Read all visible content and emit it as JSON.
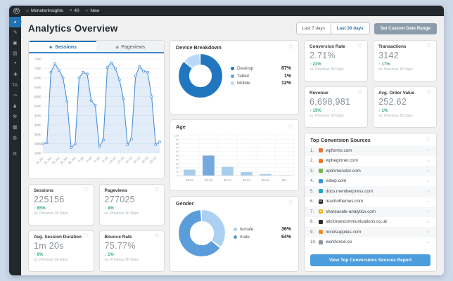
{
  "colors": {
    "accent_blue": "#2271b1",
    "button_blue": "#4b9ddd",
    "green_change": "#2fa97c",
    "admin_dark": "#23282d",
    "page_bg": "#f0f0f1"
  },
  "icons": {
    "info": "ⓘ",
    "chevron_down": "⌄",
    "arrow_up": "↑",
    "arrow_down": "↓",
    "home": "⌂",
    "comment": "❞",
    "plus": "+",
    "person": "☻",
    "eye": "◉",
    "logo_letter": "W"
  },
  "admin_bar": {
    "site_name": "MonsterInsights",
    "comments_count": "40",
    "new_label": "New"
  },
  "sidebar": {
    "items": [
      {
        "name": "dashboard",
        "glyph": "◕",
        "active": true
      },
      {
        "name": "posts",
        "glyph": "✎"
      },
      {
        "name": "media",
        "glyph": "▣"
      },
      {
        "name": "pages",
        "glyph": "▤"
      },
      {
        "name": "comments",
        "glyph": "❞"
      },
      {
        "name": "appearance",
        "glyph": "✚"
      },
      {
        "name": "text-ta",
        "glyph": "TA"
      },
      {
        "name": "plugins",
        "glyph": "✑"
      },
      {
        "name": "users",
        "glyph": "♟"
      },
      {
        "name": "tools",
        "glyph": "⚒"
      },
      {
        "name": "settings",
        "glyph": "▦"
      },
      {
        "name": "analytics",
        "glyph": "◍"
      },
      {
        "name": "collapse",
        "glyph": "⚙"
      }
    ]
  },
  "header": {
    "title": "Analytics Overview",
    "last7": "Last 7 days",
    "last30": "Last 30 days",
    "custom_range": "Set Custom Date Range"
  },
  "tabs": {
    "sessions": "Sessions",
    "pageviews": "Pageviews"
  },
  "panels": {
    "device": "Device Breakdown",
    "age": "Age",
    "gender": "Gender",
    "sources": "Top Conversion Sources"
  },
  "metrics_left": [
    {
      "label": "Sessions",
      "value": "225156",
      "change": "85%",
      "dir": "up",
      "vs": "vs. Previous 30 Days"
    },
    {
      "label": "Pageviews",
      "value": "277025",
      "change": "9%",
      "dir": "up",
      "vs": "vs. Previous 30 Days"
    },
    {
      "label": "Avg. Session Duration",
      "value": "1m 20s",
      "change": "6%",
      "dir": "up",
      "vs": "vs. Previous 30 Days"
    },
    {
      "label": "Bounce Rate",
      "value": "75.77%",
      "change": "1%",
      "dir": "down",
      "vs": "vs. Previous 30 Days"
    }
  ],
  "metrics_right": [
    {
      "label": "Conversion Rate",
      "value": "2.71%",
      "change": "22%",
      "dir": "up",
      "vs": "vs. Previous 30 Days"
    },
    {
      "label": "Transactions",
      "value": "3142",
      "change": "17%",
      "dir": "up",
      "vs": "vs. Previous 30 Days"
    },
    {
      "label": "Revenue",
      "value": "6,698,981",
      "change": "15%",
      "dir": "up",
      "vs": "vs. Previous 30 Days"
    },
    {
      "label": "Avg. Order Value",
      "value": "252.62",
      "change": "1%",
      "dir": "up",
      "vs": "vs. Previous 30 Days"
    }
  ],
  "sources": {
    "items": [
      {
        "rank": "1.",
        "domain": "wpforms.com",
        "color": "#e27730",
        "glyph": ""
      },
      {
        "rank": "2.",
        "domain": "wpbeginner.com",
        "color": "#f47a20",
        "glyph": ""
      },
      {
        "rank": "3.",
        "domain": "optinmonster.com",
        "color": "#6dbb45",
        "glyph": ""
      },
      {
        "rank": "4.",
        "domain": "isitwp.com",
        "color": "#3496d8",
        "glyph": ""
      },
      {
        "rank": "5.",
        "domain": "docs.memberpress.com",
        "color": "#1fa6c9",
        "glyph": ""
      },
      {
        "rank": "6.",
        "domain": "machothemes.com",
        "color": "#1d1f21",
        "glyph": "M"
      },
      {
        "rank": "7.",
        "domain": "shareasale-analytics.com",
        "color": "#f4b400",
        "glyph": "★"
      },
      {
        "rank": "8.",
        "domain": "stickmancommunications.co.uk",
        "color": "#2b2b2b",
        "glyph": ""
      },
      {
        "rank": "9.",
        "domain": "mindsupplies.com",
        "color": "#f08c1e",
        "glyph": ""
      },
      {
        "rank": "10.",
        "domain": "workforexl.co",
        "color": "#8e959c",
        "glyph": ""
      }
    ],
    "button_label": "View Top Conversions Sources Report"
  },
  "chart_data": [
    {
      "id": "sessions",
      "type": "line",
      "title": "Sessions",
      "x": [
        "22 Jun",
        "23 Jun",
        "24 Jun",
        "25 Jun",
        "26 Jun",
        "27 Jun",
        "28 Jun",
        "29 Jun",
        "30 Jun",
        "1 Jul",
        "2 Jul",
        "3 Jul",
        "4 Jul",
        "5 Jul",
        "6 Jul",
        "7 Jul",
        "8 Jul",
        "9 Jul",
        "10 Jul",
        "11 Jul",
        "12 Jul",
        "13 Jul",
        "14 Jul",
        "15 Jul",
        "16 Jul",
        "17 Jul",
        "18 Jul",
        "19 Jul",
        "20 Jul",
        "21 Jul"
      ],
      "values": [
        3000,
        3050,
        6800,
        7250,
        6900,
        6500,
        5250,
        2800,
        3000,
        6500,
        6800,
        6700,
        5300,
        5050,
        2850,
        3200,
        7050,
        7300,
        7000,
        6400,
        5400,
        2950,
        3250,
        6600,
        7100,
        6850,
        6800,
        5500,
        2950,
        3100
      ],
      "ylim": [
        2500,
        7500
      ],
      "ytick_step": 500,
      "xlabel_every": 2,
      "line_color": "#4a90d9",
      "fill_color": "rgba(74,144,217,0.16)",
      "grid": true,
      "legend_position": "none"
    },
    {
      "id": "device",
      "type": "pie",
      "title": "Device Breakdown",
      "labels": [
        "Desktop",
        "Tablet",
        "Mobile"
      ],
      "values": [
        87,
        1,
        12
      ],
      "display": [
        "87%",
        "1%",
        "12%"
      ],
      "colors": [
        "#2076bf",
        "#5aa7e0",
        "#b9d9f6"
      ],
      "legend_position": "right"
    },
    {
      "id": "age",
      "type": "bar",
      "title": "Age",
      "categories": [
        "18-24",
        "25-34",
        "35-44",
        "45-54",
        "55-64",
        "65+"
      ],
      "values": [
        15,
        50,
        22,
        9,
        4,
        1
      ],
      "ylim": [
        0,
        100
      ],
      "ytick_step": 10,
      "highlight_index": 1,
      "bar_color": "#a9cdec",
      "highlight_color": "#74a9dd",
      "grid": true,
      "legend_position": "none"
    },
    {
      "id": "gender",
      "type": "pie",
      "title": "Gender",
      "labels": [
        "female",
        "male"
      ],
      "values": [
        36,
        64
      ],
      "display": [
        "36%",
        "64%"
      ],
      "colors": [
        "#abd0f2",
        "#5b9ddb"
      ],
      "legend_position": "right"
    }
  ]
}
